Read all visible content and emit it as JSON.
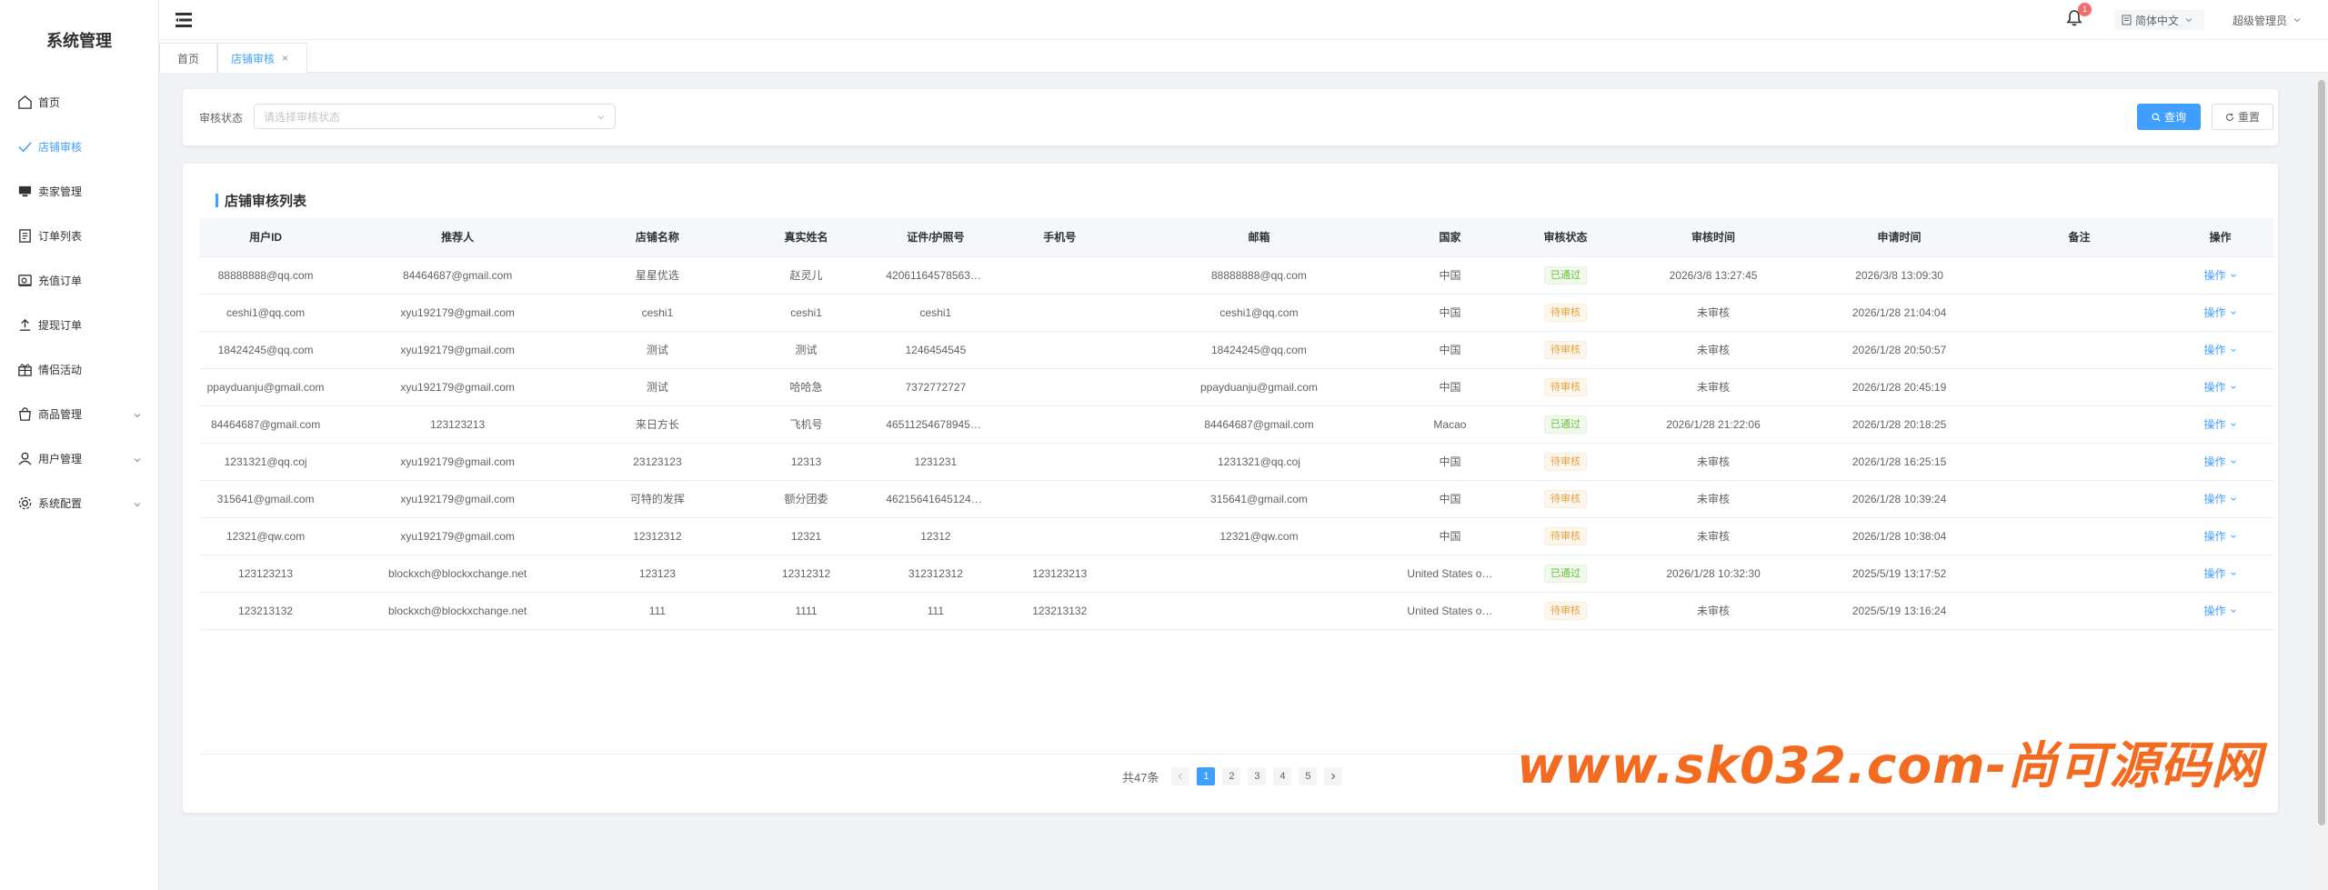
{
  "app": {
    "title": "系统管理"
  },
  "sidebar": {
    "items": [
      {
        "label": "首页",
        "icon": "home-icon",
        "active": false,
        "expandable": false
      },
      {
        "label": "店铺审核",
        "icon": "check-icon",
        "active": true,
        "expandable": false
      },
      {
        "label": "卖家管理",
        "icon": "monitor-icon",
        "active": false,
        "expandable": false
      },
      {
        "label": "订单列表",
        "icon": "document-icon",
        "active": false,
        "expandable": false
      },
      {
        "label": "充值订单",
        "icon": "wallet-icon",
        "active": false,
        "expandable": false
      },
      {
        "label": "提现订单",
        "icon": "upload-icon",
        "active": false,
        "expandable": false
      },
      {
        "label": "情侣活动",
        "icon": "gift-icon",
        "active": false,
        "expandable": false
      },
      {
        "label": "商品管理",
        "icon": "shopping-bag-icon",
        "active": false,
        "expandable": true
      },
      {
        "label": "用户管理",
        "icon": "user-icon",
        "active": false,
        "expandable": true
      },
      {
        "label": "系统配置",
        "icon": "gear-icon",
        "active": false,
        "expandable": true
      }
    ]
  },
  "header": {
    "notification_count": "1",
    "language": "简体中文",
    "user": "超级管理员"
  },
  "tabs": [
    {
      "label": "首页"
    },
    {
      "label": "店铺审核",
      "close": "×"
    }
  ],
  "search": {
    "label": "审核状态",
    "placeholder": "请选择审核状态",
    "query_label": "查询",
    "reset_label": "重置"
  },
  "list": {
    "title": "店铺审核列表",
    "columns": [
      "用户ID",
      "推荐人",
      "店铺名称",
      "真实姓名",
      "证件/护照号",
      "手机号",
      "邮箱",
      "国家",
      "审核状态",
      "审核时间",
      "申请时间",
      "备注",
      "操作"
    ],
    "rows": [
      [
        "88888888@qq.com",
        "84464687@gmail.com",
        "星星优选",
        "赵灵儿",
        "420611645785631…",
        "",
        "88888888@qq.com",
        "中国",
        "已通过",
        "2026/3/8 13:27:45",
        "2026/3/8 13:09:30",
        "",
        "操作"
      ],
      [
        "ceshi1@qq.com",
        "xyu192179@gmail.com",
        "ceshi1",
        "ceshi1",
        "ceshi1",
        "",
        "ceshi1@qq.com",
        "中国",
        "待审核",
        "未审核",
        "2026/1/28 21:04:04",
        "",
        "操作"
      ],
      [
        "18424245@qq.com",
        "xyu192179@gmail.com",
        "测试",
        "测试",
        "1246454545",
        "",
        "18424245@qq.com",
        "中国",
        "待审核",
        "未审核",
        "2026/1/28 20:50:57",
        "",
        "操作"
      ],
      [
        "ppayduanju@gmail.com",
        "xyu192179@gmail.com",
        "测试",
        "哈哈急",
        "7372772727",
        "",
        "ppayduanju@gmail.com",
        "中国",
        "待审核",
        "未审核",
        "2026/1/28 20:45:19",
        "",
        "操作"
      ],
      [
        "84464687@gmail.com",
        "123123213",
        "来日方长",
        "飞机号",
        "465112546789451…",
        "",
        "84464687@gmail.com",
        "Macao",
        "已通过",
        "2026/1/28 21:22:06",
        "2026/1/28 20:18:25",
        "",
        "操作"
      ],
      [
        "1231321@qq.coj",
        "xyu192179@gmail.com",
        "23123123",
        "12313",
        "1231231",
        "",
        "1231321@qq.coj",
        "中国",
        "待审核",
        "未审核",
        "2026/1/28 16:25:15",
        "",
        "操作"
      ],
      [
        "315641@gmail.com",
        "xyu192179@gmail.com",
        "可特的发挥",
        "额分团委",
        "462156416451245…",
        "",
        "315641@gmail.com",
        "中国",
        "待审核",
        "未审核",
        "2026/1/28 10:39:24",
        "",
        "操作"
      ],
      [
        "12321@qw.com",
        "xyu192179@gmail.com",
        "12312312",
        "12321",
        "12312",
        "",
        "12321@qw.com",
        "中国",
        "待审核",
        "未审核",
        "2026/1/28 10:38:04",
        "",
        "操作"
      ],
      [
        "123123213",
        "blockxch@blockxchange.net",
        "123123",
        "12312312",
        "312312312",
        "123123213",
        "",
        "United States o…",
        "已通过",
        "2026/1/28 10:32:30",
        "2025/5/19 13:17:52",
        "",
        "操作"
      ],
      [
        "123213132",
        "blockxch@blockxchange.net",
        "111",
        "1111",
        "111",
        "123213132",
        "",
        "United States o…",
        "待审核",
        "未审核",
        "2025/5/19 13:16:24",
        "",
        "操作"
      ]
    ]
  },
  "pagination": {
    "total_label": "共47条",
    "pages": [
      "1",
      "2",
      "3",
      "4",
      "5"
    ],
    "current": "1"
  },
  "watermark": "www.sk032.com-尚可源码网",
  "colors": {
    "primary": "#409eff",
    "success": "#67c23a",
    "warning": "#e6a23c",
    "watermark": "#f26b21"
  }
}
